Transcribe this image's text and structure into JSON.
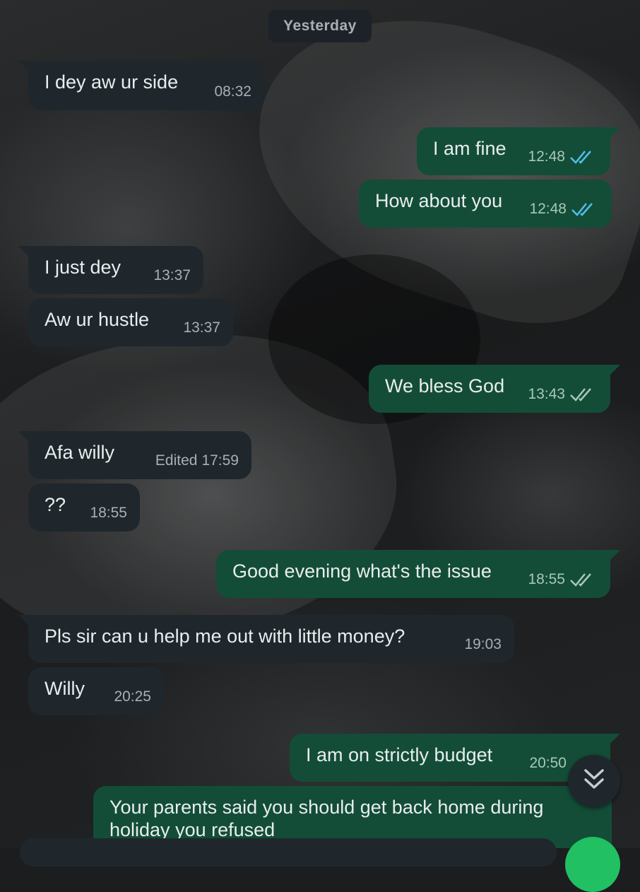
{
  "date_separator": "Yesterday",
  "messages": [
    {
      "text": "I dey aw ur side",
      "time": "08:32"
    },
    {
      "text": "I am fine",
      "time": "12:48",
      "status": "read"
    },
    {
      "text": "How about you",
      "time": "12:48",
      "status": "read"
    },
    {
      "text": "I just dey",
      "time": "13:37"
    },
    {
      "text": "Aw ur hustle",
      "time": "13:37"
    },
    {
      "text": "We bless God",
      "time": "13:43",
      "status": "delivered"
    },
    {
      "text": "Afa willy",
      "edited": "Edited",
      "time": "17:59"
    },
    {
      "text": "??",
      "time": "18:55"
    },
    {
      "text": "Good evening what's the issue",
      "time": "18:55",
      "status": "delivered"
    },
    {
      "text": "Pls sir can u help me out with little money?",
      "time": "19:03"
    },
    {
      "text": "Willy",
      "time": "20:25"
    },
    {
      "text": "I am on strictly budget",
      "time": "20:50"
    },
    {
      "text": "Your parents said you should get back home during holiday you refused",
      "time": ""
    }
  ],
  "colors": {
    "incoming_bubble": "#1f272c",
    "outgoing_bubble": "#134d37",
    "read_tick": "#53bdeb",
    "delivered_tick": "#a8c8b8",
    "accent": "#21c063"
  },
  "icons": {
    "read_receipt": "double-check-icon",
    "scroll_down": "double-chevron-down-icon",
    "mic": "mic-icon"
  }
}
